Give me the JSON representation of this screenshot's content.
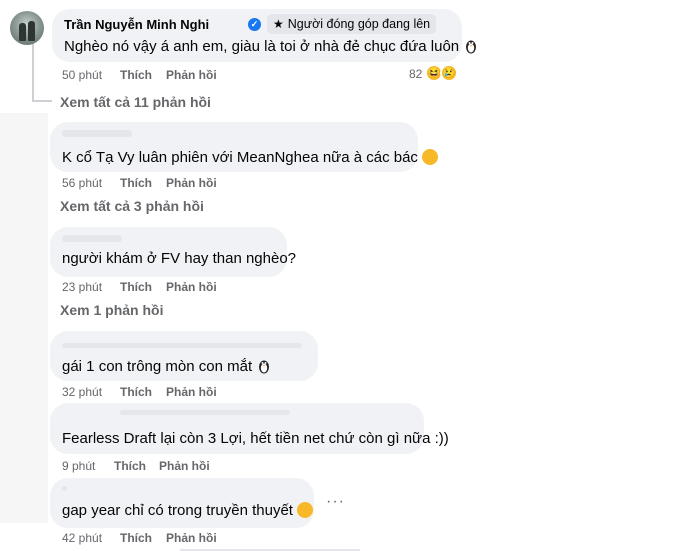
{
  "comment_main": {
    "author": "Trần Nguyễn Minh Nghi",
    "badge": "Người đóng góp đang lên",
    "text": "Nghèo nó vậy á anh em, giàu là toi ở nhà đẻ chục đứa luôn",
    "time": "50 phút",
    "like": "Thích",
    "reply": "Phản hồi",
    "reaction_count": "82",
    "reactions": [
      "laugh-emoji",
      "sad-emoji"
    ],
    "view_replies": "Xem tất cả 11 phản hồi"
  },
  "replies": [
    {
      "text": "K cổ Tạ Vy luân phiên với MeanNghea nữa à các bác",
      "time": "56 phút",
      "like": "Thích",
      "reply": "Phản hồi",
      "view_replies": "Xem tất cả 3 phản hồi"
    },
    {
      "text": "người khám ở FV hay than nghèo?",
      "time": "23 phút",
      "like": "Thích",
      "reply": "Phản hồi",
      "view_replies": "Xem 1 phản hồi"
    },
    {
      "text": "gái 1 con trông mòn con mắt",
      "time": "32 phút",
      "like": "Thích",
      "reply": "Phản hồi"
    },
    {
      "text": "Fearless Draft lại còn 3 Lợi, hết tiền net chứ còn gì nữa :))",
      "time": "9 phút",
      "like": "Thích",
      "reply": "Phản hồi"
    },
    {
      "text": "gap year chỉ có trong truyền thuyết",
      "time": "42 phút",
      "like": "Thích",
      "reply": "Phản hồi"
    }
  ],
  "more_icon": "more-horizontal-icon",
  "colors": {
    "bubble": "#f0f2f5",
    "meta": "#65676b",
    "verified": "#1877f2"
  }
}
